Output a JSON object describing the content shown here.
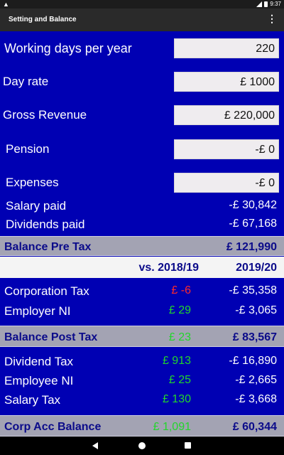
{
  "status_bar": {
    "warning_icon": "warning-icon",
    "time": "9:37"
  },
  "app_bar": {
    "title": "Setting and Balance",
    "menu_icon": "⋮"
  },
  "inputs": {
    "working_days": {
      "label": "Working days per year",
      "value": "220"
    },
    "day_rate": {
      "label": "Day rate",
      "value": "£ 1000"
    },
    "gross_revenue": {
      "label": "Gross Revenue",
      "value": "£ 220,000"
    },
    "pension": {
      "label": "Pension",
      "value": "-£ 0"
    },
    "expenses": {
      "label": "Expenses",
      "value": "-£ 0"
    }
  },
  "salary_paid": {
    "label": "Salary paid",
    "value": "-£ 30,842"
  },
  "dividends_paid": {
    "label": "Dividends paid",
    "value": "-£ 67,168"
  },
  "balance_pre_tax": {
    "label": "Balance Pre Tax",
    "value": "£ 121,990"
  },
  "comparison_header": {
    "vs": "vs. 2018/19",
    "year": "2019/20"
  },
  "corporation_tax": {
    "label": "Corporation Tax",
    "diff": "£ -6",
    "value": "-£ 35,358"
  },
  "employer_ni": {
    "label": "Employer NI",
    "diff": "£ 29",
    "value": "-£ 3,065"
  },
  "balance_post_tax": {
    "label": "Balance Post Tax",
    "diff": "£ 23",
    "value": "£ 83,567"
  },
  "dividend_tax": {
    "label": "Dividend Tax",
    "diff": "£ 913",
    "value": "-£ 16,890"
  },
  "employee_ni": {
    "label": "Employee NI",
    "diff": "£ 25",
    "value": "-£ 2,665"
  },
  "salary_tax": {
    "label": "Salary Tax",
    "diff": "£ 130",
    "value": "-£ 3,668"
  },
  "corp_acc_balance": {
    "label": "Corp Acc Balance",
    "diff": "£ 1,091",
    "value": "£ 60,344"
  },
  "colors": {
    "background": "#0000b3",
    "band_gray": "#a3a3b3",
    "positive": "#22d62b",
    "negative": "#ff2a2a",
    "band_text": "#0b0b8a"
  }
}
